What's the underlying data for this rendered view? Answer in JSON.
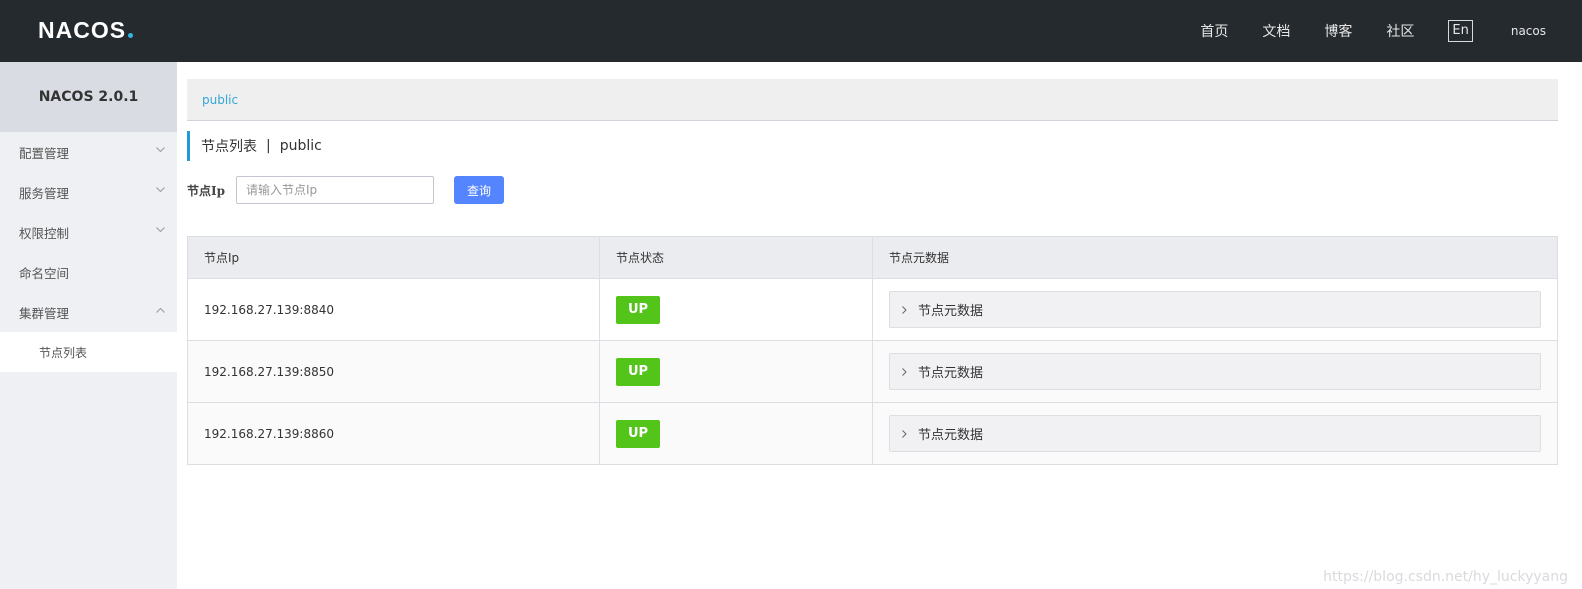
{
  "header": {
    "logo_text": "NACOS",
    "nav": [
      "首页",
      "文档",
      "博客",
      "社区"
    ],
    "lang_button": "En",
    "user": "nacos"
  },
  "sidebar": {
    "title": "NACOS 2.0.1",
    "items": [
      {
        "label": "配置管理",
        "chevron": "chevron-down-icon"
      },
      {
        "label": "服务管理",
        "chevron": "chevron-down-icon"
      },
      {
        "label": "权限控制",
        "chevron": "chevron-down-icon"
      },
      {
        "label": "命名空间"
      },
      {
        "label": "集群管理",
        "chevron": "chevron-up-icon"
      }
    ],
    "subitems": [
      "节点列表"
    ]
  },
  "namespace_bar": {
    "current": "public"
  },
  "page": {
    "title": "节点列表",
    "separator": "|",
    "namespace": "public"
  },
  "search": {
    "label": "节点Ip",
    "placeholder": "请输入节点Ip",
    "value": "",
    "button": "查询"
  },
  "table": {
    "columns": [
      "节点Ip",
      "节点状态",
      "节点元数据"
    ],
    "rows": [
      {
        "ip": "192.168.27.139:8840",
        "status": "UP",
        "meta": "节点元数据"
      },
      {
        "ip": "192.168.27.139:8850",
        "status": "UP",
        "meta": "节点元数据"
      },
      {
        "ip": "192.168.27.139:8860",
        "status": "UP",
        "meta": "节点元数据"
      }
    ]
  },
  "watermark": "https://blog.csdn.net/hy_luckyyang",
  "colors": {
    "header_bg": "#252a2f",
    "accent": "#209bd8",
    "button": "#5584ff",
    "status_up": "#52c41a"
  }
}
